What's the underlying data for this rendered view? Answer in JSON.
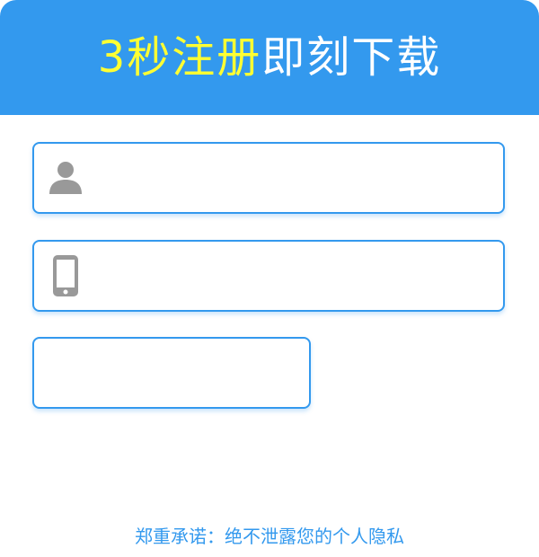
{
  "header": {
    "title_highlight": "3秒注册",
    "title_rest": "即刻下载",
    "background": "#3399ee",
    "highlight_color": "#ffff33"
  },
  "form": {
    "name_field": {
      "icon": "user-icon",
      "value": "",
      "placeholder": ""
    },
    "phone_field": {
      "icon": "phone-icon",
      "value": "",
      "placeholder": ""
    },
    "code_field": {
      "value": "",
      "placeholder": ""
    }
  },
  "footer": {
    "privacy_text": "郑重承诺：绝不泄露您的个人隐私"
  },
  "colors": {
    "accent": "#3399ee",
    "icon_gray": "#999999"
  }
}
